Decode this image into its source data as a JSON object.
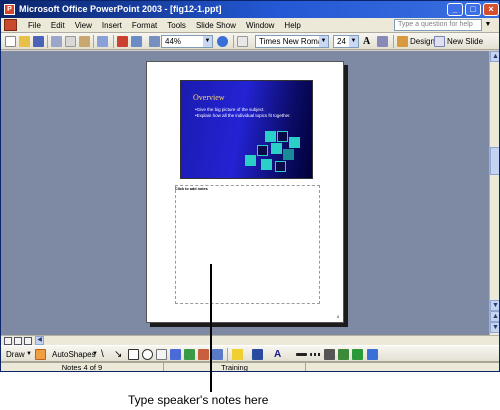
{
  "window": {
    "title": "Microsoft Office PowerPoint 2003 - [fig12-1.ppt]",
    "controls": [
      "_",
      "□",
      "×"
    ]
  },
  "menubar": {
    "items": [
      "File",
      "Edit",
      "View",
      "Insert",
      "Format",
      "Tools",
      "Slide Show",
      "Window",
      "Help"
    ],
    "help_box_placeholder": "Type a question for help"
  },
  "toolbar": {
    "zoom": "44%",
    "font_name": "Times New Roman",
    "font_size": "24",
    "design_label": "Design",
    "new_slide_label": "New Slide"
  },
  "slide": {
    "title": "Overview",
    "bullets": [
      "Give the big picture of the subject.",
      "Explain how all the individual topics fit together."
    ],
    "puzzle_color": "#2ad0c8"
  },
  "notes_page": {
    "notes_label": "Click to add notes",
    "page_number": "4"
  },
  "drawbar": {
    "draw_label": "Draw",
    "autoshapes_label": "AutoShapes"
  },
  "statusbar": {
    "slide_position": "Notes 4 of 9",
    "design_template": "Training"
  },
  "callout": {
    "text": "Type speaker's notes here"
  },
  "colors": {
    "titlebar": "#0a246a",
    "workspace": "#7e8aa3",
    "slide_background": "#2323d4",
    "slide_title": "#ffd86a"
  }
}
